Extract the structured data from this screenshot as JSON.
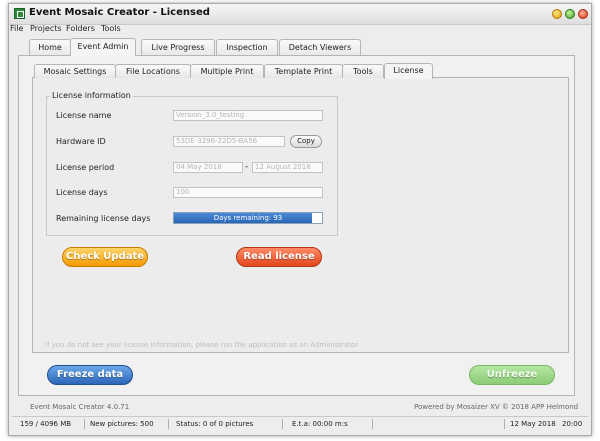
{
  "window": {
    "title": "Event Mosaic Creator - Licensed"
  },
  "menu": {
    "items": [
      "File",
      "Projects",
      "Folders",
      "Tools"
    ]
  },
  "tabs": [
    "Home",
    "Event Admin",
    "Live Progress",
    "Inspection",
    "Detach Viewers"
  ],
  "subtabs": [
    "Mosaic Settings",
    "File Locations",
    "Multiple Print",
    "Template Print",
    "Tools",
    "License"
  ],
  "license": {
    "group_title": "License information",
    "name_label": "License name",
    "name_value": "Version_3.0_testing",
    "hardware_label": "Hardware ID",
    "hardware_value": "53DE-3296-22D5-BA56",
    "copy_label": "Copy",
    "period_label": "License period",
    "period_start": "04 May 2018",
    "period_separator": "-",
    "period_end": "12 August 2018",
    "days_label": "License days",
    "days_value": "100",
    "remaining_label": "Remaining license days",
    "remaining_text": "Days remaining: 93",
    "remaining_fraction": 0.93
  },
  "buttons": {
    "check_update": "Check Update",
    "read_license": "Read license",
    "freeze": "Freeze data",
    "unfreeze": "Unfreeze"
  },
  "hint": "If you do not see your license information, please run the application as an Administrator",
  "footer": {
    "version": "Event Mosaic Creator 4.0.71",
    "powered": "Powered by Mosaizer XV © 2018  APP Helmond"
  },
  "statusbar": {
    "memory": "159 / 4096 MB",
    "new_pictures": "New pictures: 500",
    "status": "Status: 0 of 0 pictures",
    "eta": "E.t.a: 00:00 m:s",
    "date": "12 May 2018",
    "time": "20:00"
  },
  "colors": {
    "check_update": "#f59a00",
    "read_license": "#e2461c",
    "freeze": "#2d66b8",
    "unfreeze": "#8ccc77",
    "progress": "#2766b5"
  }
}
